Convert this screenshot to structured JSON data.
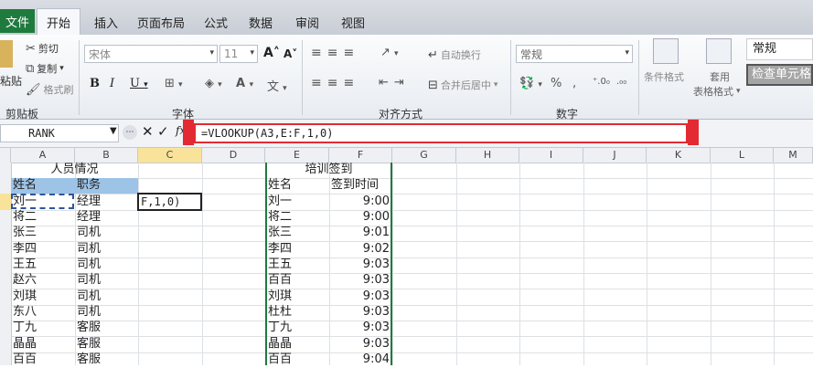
{
  "tabs": {
    "file": "文件",
    "home": "开始",
    "insert": "插入",
    "layout": "页面布局",
    "formulas": "公式",
    "data": "数据",
    "review": "审阅",
    "view": "视图"
  },
  "ribbon": {
    "paste": "粘贴",
    "cut": "剪切",
    "copy": "复制",
    "format_painter": "格式刷",
    "clipboard_group": "剪贴板",
    "font_name": "宋体",
    "font_size": "11",
    "font_group": "字体",
    "wrap_text": "自动换行",
    "merge_center": "合并后居中",
    "align_group": "对齐方式",
    "number_format": "常规",
    "number_group": "数字",
    "cond_format": "条件格式",
    "table_format_1": "套用",
    "table_format_2": "表格格式",
    "style_normal": "常规",
    "style_check": "检查单元格"
  },
  "formula_bar": {
    "name_box": "RANK",
    "formula": "=VLOOKUP(A3,E:F,1,0)"
  },
  "columns": [
    "A",
    "B",
    "C",
    "D",
    "E",
    "F",
    "G",
    "H",
    "I",
    "J",
    "K",
    "L",
    "M"
  ],
  "row_numbers": [
    "",
    "",
    "",
    "",
    "",
    "",
    "",
    "",
    "",
    "",
    "",
    "",
    "",
    ""
  ],
  "sheet": {
    "left_title": "人员情况",
    "left_headers": [
      "姓名",
      "职务"
    ],
    "left_rows": [
      [
        "刘一",
        "经理"
      ],
      [
        "将二",
        "经理"
      ],
      [
        "张三",
        "司机"
      ],
      [
        "李四",
        "司机"
      ],
      [
        "王五",
        "司机"
      ],
      [
        "赵六",
        "司机"
      ],
      [
        "刘琪",
        "司机"
      ],
      [
        "东八",
        "司机"
      ],
      [
        "丁九",
        "客服"
      ],
      [
        "晶晶",
        "客服"
      ],
      [
        "百百",
        "客服"
      ]
    ],
    "editing_cell": "F,1,0)",
    "right_title": "培训签到",
    "right_headers": [
      "姓名",
      "签到时间"
    ],
    "right_rows": [
      [
        "刘一",
        "9:00"
      ],
      [
        "将二",
        "9:00"
      ],
      [
        "张三",
        "9:01"
      ],
      [
        "李四",
        "9:02"
      ],
      [
        "王五",
        "9:03"
      ],
      [
        "百百",
        "9:03"
      ],
      [
        "刘琪",
        "9:03"
      ],
      [
        "杜杜",
        "9:03"
      ],
      [
        "丁九",
        "9:03"
      ],
      [
        "晶晶",
        "9:03"
      ],
      [
        "百百",
        "9:04"
      ]
    ]
  },
  "colors": {
    "file_tab": "#1f7a3e",
    "header_fill": "#9dc3e6",
    "highlight": "#e32a33",
    "selection_border": "#1f7a3e"
  }
}
